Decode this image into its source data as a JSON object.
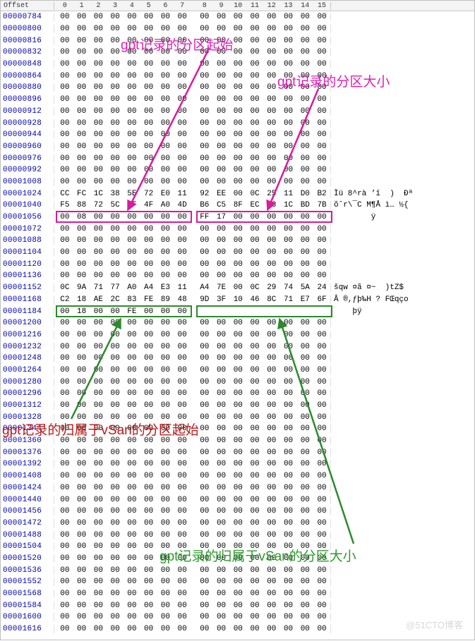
{
  "header": {
    "offset_col": "Offset",
    "byte_cols": [
      "0",
      "1",
      "2",
      "3",
      "4",
      "5",
      "6",
      "7",
      "8",
      "9",
      "10",
      "11",
      "12",
      "13",
      "14",
      "15"
    ]
  },
  "annotations": {
    "a1": "gpt记录的分区起始",
    "a2": "gpt记录的分区大小",
    "a3": "gpt记录的归属于vSan的分区起始",
    "a4": "gpt记录的归属于vSan的分区大小"
  },
  "watermark": "@51CTO博客",
  "rows": [
    {
      "offset": "00000784",
      "bytes": [
        "00",
        "00",
        "00",
        "00",
        "00",
        "00",
        "00",
        "00",
        "00",
        "00",
        "00",
        "00",
        "00",
        "00",
        "00",
        "00"
      ],
      "ascii": ""
    },
    {
      "offset": "00000800",
      "bytes": [
        "00",
        "00",
        "00",
        "00",
        "00",
        "00",
        "00",
        "00",
        "00",
        "00",
        "00",
        "00",
        "00",
        "00",
        "00",
        "00"
      ],
      "ascii": ""
    },
    {
      "offset": "00000816",
      "bytes": [
        "00",
        "00",
        "00",
        "00",
        "00",
        "00",
        "00",
        "00",
        "00",
        "00",
        "00",
        "00",
        "00",
        "00",
        "00",
        "00"
      ],
      "ascii": ""
    },
    {
      "offset": "00000832",
      "bytes": [
        "00",
        "00",
        "00",
        "00",
        "00",
        "00",
        "00",
        "00",
        "00",
        "00",
        "00",
        "00",
        "00",
        "00",
        "00",
        "00"
      ],
      "ascii": ""
    },
    {
      "offset": "00000848",
      "bytes": [
        "00",
        "00",
        "00",
        "00",
        "00",
        "00",
        "00",
        "00",
        "00",
        "00",
        "00",
        "00",
        "00",
        "00",
        "00",
        "00"
      ],
      "ascii": ""
    },
    {
      "offset": "00000864",
      "bytes": [
        "00",
        "00",
        "00",
        "00",
        "00",
        "00",
        "00",
        "00",
        "00",
        "00",
        "00",
        "00",
        "00",
        "00",
        "00",
        "00"
      ],
      "ascii": ""
    },
    {
      "offset": "00000880",
      "bytes": [
        "00",
        "00",
        "00",
        "00",
        "00",
        "00",
        "00",
        "00",
        "00",
        "00",
        "00",
        "00",
        "00",
        "00",
        "00",
        "00"
      ],
      "ascii": ""
    },
    {
      "offset": "00000896",
      "bytes": [
        "00",
        "00",
        "00",
        "00",
        "00",
        "00",
        "00",
        "00",
        "00",
        "00",
        "00",
        "00",
        "00",
        "00",
        "00",
        "00"
      ],
      "ascii": ""
    },
    {
      "offset": "00000912",
      "bytes": [
        "00",
        "00",
        "00",
        "00",
        "00",
        "00",
        "00",
        "00",
        "00",
        "00",
        "00",
        "00",
        "00",
        "00",
        "00",
        "00"
      ],
      "ascii": ""
    },
    {
      "offset": "00000928",
      "bytes": [
        "00",
        "00",
        "00",
        "00",
        "00",
        "00",
        "00",
        "00",
        "00",
        "00",
        "00",
        "00",
        "00",
        "00",
        "00",
        "00"
      ],
      "ascii": ""
    },
    {
      "offset": "00000944",
      "bytes": [
        "00",
        "00",
        "00",
        "00",
        "00",
        "00",
        "00",
        "00",
        "00",
        "00",
        "00",
        "00",
        "00",
        "00",
        "00",
        "00"
      ],
      "ascii": ""
    },
    {
      "offset": "00000960",
      "bytes": [
        "00",
        "00",
        "00",
        "00",
        "00",
        "00",
        "00",
        "00",
        "00",
        "00",
        "00",
        "00",
        "00",
        "00",
        "00",
        "00"
      ],
      "ascii": ""
    },
    {
      "offset": "00000976",
      "bytes": [
        "00",
        "00",
        "00",
        "00",
        "00",
        "00",
        "00",
        "00",
        "00",
        "00",
        "00",
        "00",
        "00",
        "00",
        "00",
        "00"
      ],
      "ascii": ""
    },
    {
      "offset": "00000992",
      "bytes": [
        "00",
        "00",
        "00",
        "00",
        "00",
        "00",
        "00",
        "00",
        "00",
        "00",
        "00",
        "00",
        "00",
        "00",
        "00",
        "00"
      ],
      "ascii": ""
    },
    {
      "offset": "00001008",
      "bytes": [
        "00",
        "00",
        "00",
        "00",
        "00",
        "00",
        "00",
        "00",
        "00",
        "00",
        "00",
        "00",
        "00",
        "00",
        "00",
        "00"
      ],
      "ascii": ""
    },
    {
      "offset": "00001024",
      "bytes": [
        "CC",
        "FC",
        "1C",
        "38",
        "5E",
        "72",
        "E0",
        "11",
        "92",
        "EE",
        "00",
        "0C",
        "25",
        "11",
        "D0",
        "B2"
      ],
      "ascii": "Ìü 8^rà ’î  )  Ðª"
    },
    {
      "offset": "00001040",
      "bytes": [
        "F5",
        "88",
        "72",
        "5C",
        "AF",
        "4F",
        "A0",
        "4D",
        "B6",
        "C5",
        "8F",
        "EC",
        "78",
        "1C",
        "BD",
        "7B"
      ],
      "ascii": "õˆr\\¯C M¶Å ì… ½{"
    },
    {
      "offset": "00001056",
      "bytes": [
        "00",
        "08",
        "00",
        "00",
        "00",
        "00",
        "00",
        "00",
        "FF",
        "17",
        "00",
        "00",
        "00",
        "00",
        "00",
        "00"
      ],
      "ascii": "        ÿ"
    },
    {
      "offset": "00001072",
      "bytes": [
        "00",
        "00",
        "00",
        "00",
        "00",
        "00",
        "00",
        "00",
        "00",
        "00",
        "00",
        "00",
        "00",
        "00",
        "00",
        "00"
      ],
      "ascii": ""
    },
    {
      "offset": "00001088",
      "bytes": [
        "00",
        "00",
        "00",
        "00",
        "00",
        "00",
        "00",
        "00",
        "00",
        "00",
        "00",
        "00",
        "00",
        "00",
        "00",
        "00"
      ],
      "ascii": ""
    },
    {
      "offset": "00001104",
      "bytes": [
        "00",
        "00",
        "00",
        "00",
        "00",
        "00",
        "00",
        "00",
        "00",
        "00",
        "00",
        "00",
        "00",
        "00",
        "00",
        "00"
      ],
      "ascii": ""
    },
    {
      "offset": "00001120",
      "bytes": [
        "00",
        "00",
        "00",
        "00",
        "00",
        "00",
        "00",
        "00",
        "00",
        "00",
        "00",
        "00",
        "00",
        "00",
        "00",
        "00"
      ],
      "ascii": ""
    },
    {
      "offset": "00001136",
      "bytes": [
        "00",
        "00",
        "00",
        "00",
        "00",
        "00",
        "00",
        "00",
        "00",
        "00",
        "00",
        "00",
        "00",
        "00",
        "00",
        "00"
      ],
      "ascii": ""
    },
    {
      "offset": "00001152",
      "bytes": [
        "0C",
        "9A",
        "71",
        "77",
        "A0",
        "A4",
        "E3",
        "11",
        "A4",
        "7E",
        "00",
        "0C",
        "29",
        "74",
        "5A",
        "24"
      ],
      "ascii": "šqw ¤ã ¤~  )tZ$"
    },
    {
      "offset": "00001168",
      "bytes": [
        "C2",
        "18",
        "AE",
        "2C",
        "83",
        "FE",
        "89",
        "48",
        "9D",
        "3F",
        "10",
        "46",
        "8C",
        "71",
        "E7",
        "6F"
      ],
      "ascii": "Â ®,ƒþ‰H ? FŒqço"
    },
    {
      "offset": "00001184",
      "bytes": [
        "00",
        "18",
        "00",
        "00",
        "FE",
        "00",
        "00",
        "00",
        "",
        "",
        "",
        "",
        "",
        "",
        "",
        ""
      ],
      "ascii": "    þÿ"
    },
    {
      "offset": "00001200",
      "bytes": [
        "00",
        "00",
        "00",
        "00",
        "00",
        "00",
        "00",
        "00",
        "00",
        "00",
        "00",
        "00",
        "00",
        "00",
        "00",
        "00"
      ],
      "ascii": ""
    },
    {
      "offset": "00001216",
      "bytes": [
        "00",
        "00",
        "00",
        "00",
        "00",
        "00",
        "00",
        "00",
        "00",
        "00",
        "00",
        "00",
        "00",
        "00",
        "00",
        "00"
      ],
      "ascii": ""
    },
    {
      "offset": "00001232",
      "bytes": [
        "00",
        "00",
        "00",
        "00",
        "00",
        "00",
        "00",
        "00",
        "00",
        "00",
        "00",
        "00",
        "00",
        "00",
        "00",
        "00"
      ],
      "ascii": ""
    },
    {
      "offset": "00001248",
      "bytes": [
        "00",
        "00",
        "00",
        "00",
        "00",
        "00",
        "00",
        "00",
        "00",
        "00",
        "00",
        "00",
        "00",
        "00",
        "00",
        "00"
      ],
      "ascii": ""
    },
    {
      "offset": "00001264",
      "bytes": [
        "00",
        "00",
        "00",
        "00",
        "00",
        "00",
        "00",
        "00",
        "00",
        "00",
        "00",
        "00",
        "00",
        "00",
        "00",
        "00"
      ],
      "ascii": ""
    },
    {
      "offset": "00001280",
      "bytes": [
        "00",
        "00",
        "00",
        "00",
        "00",
        "00",
        "00",
        "00",
        "00",
        "00",
        "00",
        "00",
        "00",
        "00",
        "00",
        "00"
      ],
      "ascii": ""
    },
    {
      "offset": "00001296",
      "bytes": [
        "00",
        "00",
        "00",
        "00",
        "00",
        "00",
        "00",
        "00",
        "00",
        "00",
        "00",
        "00",
        "00",
        "00",
        "00",
        "00"
      ],
      "ascii": ""
    },
    {
      "offset": "00001312",
      "bytes": [
        "00",
        "00",
        "00",
        "00",
        "00",
        "00",
        "00",
        "00",
        "00",
        "00",
        "00",
        "00",
        "00",
        "00",
        "00",
        "00"
      ],
      "ascii": ""
    },
    {
      "offset": "00001328",
      "bytes": [
        "00",
        "00",
        "00",
        "00",
        "00",
        "00",
        "00",
        "00",
        "00",
        "00",
        "00",
        "00",
        "00",
        "00",
        "00",
        "00"
      ],
      "ascii": ""
    },
    {
      "offset": "00001344",
      "bytes": [
        "00",
        "00",
        "00",
        "00",
        "00",
        "00",
        "00",
        "00",
        "00",
        "00",
        "00",
        "00",
        "00",
        "00",
        "00",
        "00"
      ],
      "ascii": ""
    },
    {
      "offset": "00001360",
      "bytes": [
        "00",
        "00",
        "00",
        "00",
        "00",
        "00",
        "00",
        "00",
        "00",
        "00",
        "00",
        "00",
        "00",
        "00",
        "00",
        "00"
      ],
      "ascii": ""
    },
    {
      "offset": "00001376",
      "bytes": [
        "00",
        "00",
        "00",
        "00",
        "00",
        "00",
        "00",
        "00",
        "00",
        "00",
        "00",
        "00",
        "00",
        "00",
        "00",
        "00"
      ],
      "ascii": ""
    },
    {
      "offset": "00001392",
      "bytes": [
        "00",
        "00",
        "00",
        "00",
        "00",
        "00",
        "00",
        "00",
        "00",
        "00",
        "00",
        "00",
        "00",
        "00",
        "00",
        "00"
      ],
      "ascii": ""
    },
    {
      "offset": "00001408",
      "bytes": [
        "00",
        "00",
        "00",
        "00",
        "00",
        "00",
        "00",
        "00",
        "00",
        "00",
        "00",
        "00",
        "00",
        "00",
        "00",
        "00"
      ],
      "ascii": ""
    },
    {
      "offset": "00001424",
      "bytes": [
        "00",
        "00",
        "00",
        "00",
        "00",
        "00",
        "00",
        "00",
        "00",
        "00",
        "00",
        "00",
        "00",
        "00",
        "00",
        "00"
      ],
      "ascii": ""
    },
    {
      "offset": "00001440",
      "bytes": [
        "00",
        "00",
        "00",
        "00",
        "00",
        "00",
        "00",
        "00",
        "00",
        "00",
        "00",
        "00",
        "00",
        "00",
        "00",
        "00"
      ],
      "ascii": ""
    },
    {
      "offset": "00001456",
      "bytes": [
        "00",
        "00",
        "00",
        "00",
        "00",
        "00",
        "00",
        "00",
        "00",
        "00",
        "00",
        "00",
        "00",
        "00",
        "00",
        "00"
      ],
      "ascii": ""
    },
    {
      "offset": "00001472",
      "bytes": [
        "00",
        "00",
        "00",
        "00",
        "00",
        "00",
        "00",
        "00",
        "00",
        "00",
        "00",
        "00",
        "00",
        "00",
        "00",
        "00"
      ],
      "ascii": ""
    },
    {
      "offset": "00001488",
      "bytes": [
        "00",
        "00",
        "00",
        "00",
        "00",
        "00",
        "00",
        "00",
        "00",
        "00",
        "00",
        "00",
        "00",
        "00",
        "00",
        "00"
      ],
      "ascii": ""
    },
    {
      "offset": "00001504",
      "bytes": [
        "00",
        "00",
        "00",
        "00",
        "00",
        "00",
        "00",
        "00",
        "00",
        "00",
        "00",
        "00",
        "00",
        "00",
        "00",
        "00"
      ],
      "ascii": ""
    },
    {
      "offset": "00001520",
      "bytes": [
        "00",
        "00",
        "00",
        "00",
        "00",
        "00",
        "00",
        "00",
        "00",
        "00",
        "00",
        "00",
        "00",
        "00",
        "00",
        "00"
      ],
      "ascii": ""
    },
    {
      "offset": "00001536",
      "bytes": [
        "00",
        "00",
        "00",
        "00",
        "00",
        "00",
        "00",
        "00",
        "00",
        "00",
        "00",
        "00",
        "00",
        "00",
        "00",
        "00"
      ],
      "ascii": ""
    },
    {
      "offset": "00001552",
      "bytes": [
        "00",
        "00",
        "00",
        "00",
        "00",
        "00",
        "00",
        "00",
        "00",
        "00",
        "00",
        "00",
        "00",
        "00",
        "00",
        "00"
      ],
      "ascii": ""
    },
    {
      "offset": "00001568",
      "bytes": [
        "00",
        "00",
        "00",
        "00",
        "00",
        "00",
        "00",
        "00",
        "00",
        "00",
        "00",
        "00",
        "00",
        "00",
        "00",
        "00"
      ],
      "ascii": ""
    },
    {
      "offset": "00001584",
      "bytes": [
        "00",
        "00",
        "00",
        "00",
        "00",
        "00",
        "00",
        "00",
        "00",
        "00",
        "00",
        "00",
        "00",
        "00",
        "00",
        "00"
      ],
      "ascii": ""
    },
    {
      "offset": "00001600",
      "bytes": [
        "00",
        "00",
        "00",
        "00",
        "00",
        "00",
        "00",
        "00",
        "00",
        "00",
        "00",
        "00",
        "00",
        "00",
        "00",
        "00"
      ],
      "ascii": ""
    },
    {
      "offset": "00001616",
      "bytes": [
        "00",
        "00",
        "00",
        "00",
        "00",
        "00",
        "00",
        "00",
        "00",
        "00",
        "00",
        "00",
        "00",
        "00",
        "00",
        "00"
      ],
      "ascii": ""
    }
  ],
  "highlights": [
    {
      "row": 17,
      "start": 0,
      "end": 7,
      "color": "magenta"
    },
    {
      "row": 17,
      "start": 8,
      "end": 15,
      "color": "magenta"
    },
    {
      "row": 25,
      "start": 0,
      "end": 7,
      "color": "green"
    },
    {
      "row": 25,
      "start": 8,
      "end": 15,
      "color": "green"
    }
  ]
}
